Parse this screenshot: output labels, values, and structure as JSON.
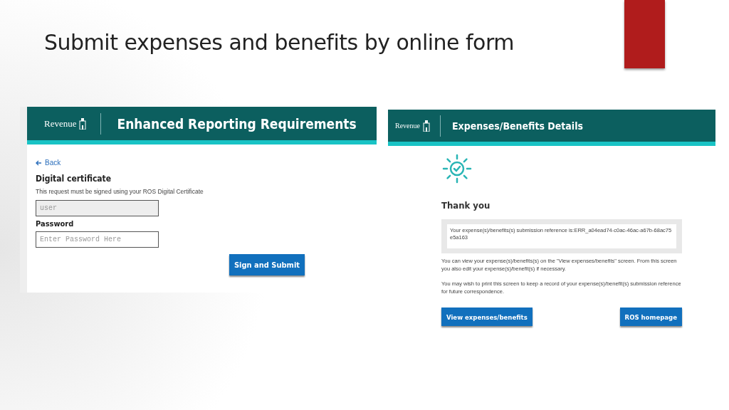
{
  "slide": {
    "title": "Submit expenses and benefits by online form"
  },
  "login_screen": {
    "logo": "Revenue",
    "header": "Enhanced Reporting Requirements",
    "back_link": "Back",
    "heading": "Digital certificate",
    "description": "This request must be signed using your ROS Digital Certificate",
    "fields": [
      {
        "value": "user",
        "disabled": true
      },
      {
        "label": "Password",
        "placeholder": "Enter Password Here",
        "disabled": false
      }
    ],
    "submit_button": "Sign and Submit"
  },
  "confirmation_screen": {
    "logo": "Revenue",
    "header": "Expenses/Benefits Details",
    "heading": "Thank you",
    "reference": "Your expense(s)/benefits(s) submission reference is:ERR_a04ead74-c0ac-46ac-a67b-68ac75e5a163",
    "paragraphs": [
      "You can view your expense(s)/benefits(s) on the \"View expenses/benefits\" screen. From this screen you also edit your expense(s)/benefit(s) if necessary.",
      "You may wish to print this screen to keep a record of your expense(s)/benefit(s) submission reference for future correspondence."
    ],
    "buttons": [
      "View expenses/benefits",
      "ROS homepage"
    ]
  }
}
